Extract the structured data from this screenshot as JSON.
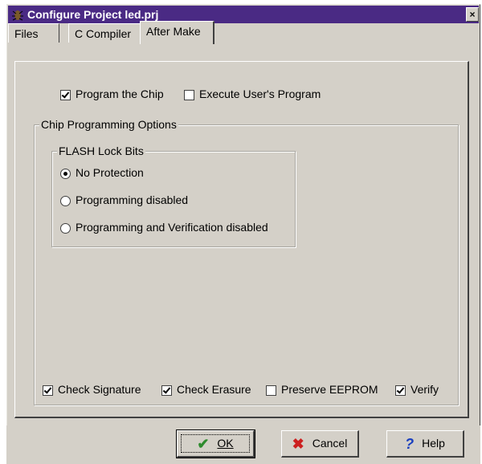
{
  "window": {
    "title": "Configure Project led.prj",
    "close_glyph": "×"
  },
  "tabs": [
    {
      "label": "Files",
      "active": false
    },
    {
      "label": "C Compiler",
      "active": false
    },
    {
      "label": "After Make",
      "active": true
    }
  ],
  "after_make": {
    "program_chip": {
      "label": "Program the Chip",
      "checked": true
    },
    "execute_program": {
      "label": "Execute User's Program",
      "checked": false
    }
  },
  "chip_options": {
    "title": "Chip Programming Options",
    "flash_lock": {
      "title": "FLASH Lock Bits",
      "options": [
        {
          "label": "No Protection",
          "selected": true
        },
        {
          "label": "Programming disabled",
          "selected": false
        },
        {
          "label": "Programming and Verification disabled",
          "selected": false
        }
      ]
    }
  },
  "checks": [
    {
      "label": "Check Signature",
      "checked": true
    },
    {
      "label": "Check Erasure",
      "checked": true
    },
    {
      "label": "Preserve EEPROM",
      "checked": false
    },
    {
      "label": "Verify",
      "checked": true
    }
  ],
  "buttons": {
    "ok": "OK",
    "cancel": "Cancel",
    "help": "Help"
  },
  "icons": {
    "app": "bug-icon",
    "ok": "checkmark-icon",
    "cancel": "x-icon",
    "help": "question-icon"
  },
  "colors": {
    "titlebar": "#4a2a84",
    "ok_icon": "#2e8b2e",
    "cancel_icon": "#cc2020",
    "help_icon": "#1a3fbf",
    "face": "#d4d0c8"
  }
}
